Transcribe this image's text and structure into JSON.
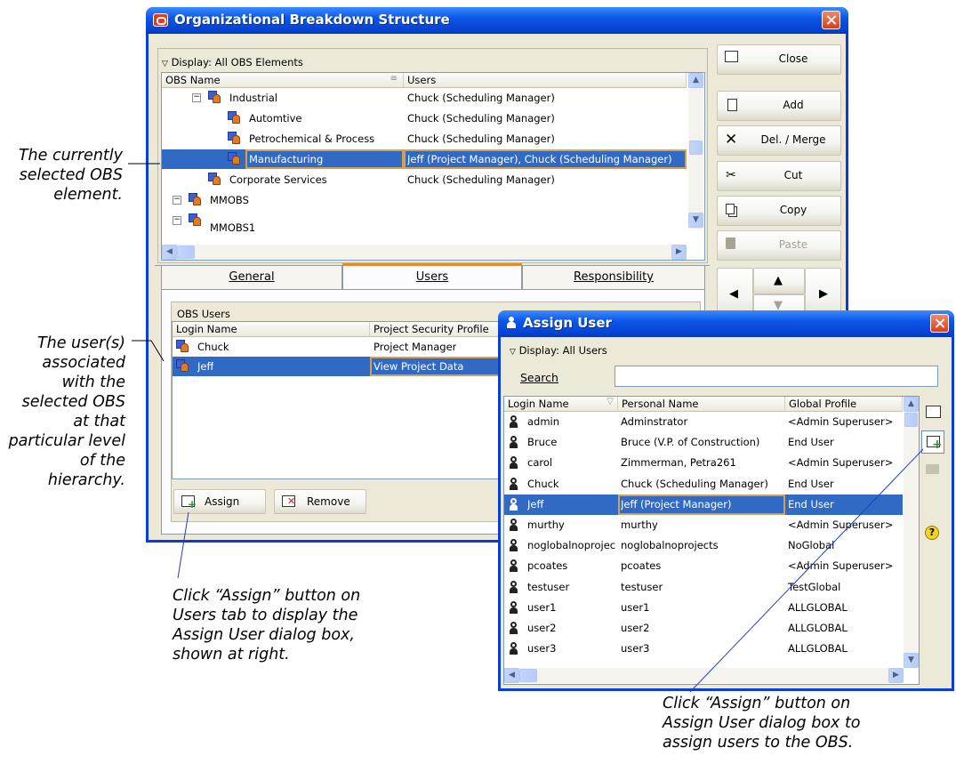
{
  "annotations": {
    "selected_obs": [
      "The currently",
      "selected OBS",
      "element."
    ],
    "users_assoc": [
      "The user(s)",
      "associated",
      "with the",
      "selected OBS",
      "at that",
      "particular level",
      "of the",
      "hierarchy."
    ],
    "assign_click": [
      "Click “Assign” button on",
      "Users tab to display the",
      "Assign User dialog box,",
      "shown at right."
    ],
    "assign_dialog_click": [
      "Click “Assign” button on",
      "Assign User dialog box to",
      "assign users to the OBS."
    ]
  },
  "obs_window": {
    "title": "Organizational Breakdown Structure",
    "display_label": "Display: All OBS Elements",
    "columns": [
      "OBS Name",
      "Users"
    ],
    "rows": [
      {
        "name": "Industrial",
        "users": "Chuck (Scheduling Manager)"
      },
      {
        "name": "Automtive",
        "users": "Chuck (Scheduling Manager)"
      },
      {
        "name": "Petrochemical & Process",
        "users": "Chuck (Scheduling Manager)"
      },
      {
        "name": "Manufacturing",
        "users": "Jeff (Project Manager), Chuck (Scheduling Manager)"
      },
      {
        "name": "Corporate Services",
        "users": "Chuck (Scheduling Manager)"
      },
      {
        "name": "MMOBS",
        "users": ""
      },
      {
        "name": "MMOBS1",
        "users": ""
      }
    ],
    "buttons": {
      "close": "Close",
      "add": "Add",
      "del_merge": "Del. / Merge",
      "cut": "Cut",
      "copy": "Copy",
      "paste": "Paste"
    },
    "tabs": [
      "General",
      "Users",
      "Responsibility"
    ],
    "obs_users_label": "OBS Users",
    "user_columns": [
      "Login Name",
      "Project Security Profile"
    ],
    "user_rows": [
      {
        "login": "Chuck",
        "profile": "Project Manager"
      },
      {
        "login": "Jeff",
        "profile": "View Project Data"
      }
    ],
    "assign_label": "Assign",
    "remove_label": "Remove"
  },
  "assign_window": {
    "title": "Assign User",
    "display_label": "Display: All Users",
    "search_label": "Search",
    "search_value": "",
    "columns": [
      "Login Name",
      "Personal Name",
      "Global Profile"
    ],
    "rows": [
      {
        "login": "admin",
        "personal": "Adminstrator",
        "profile": "<Admin Superuser>"
      },
      {
        "login": "Bruce",
        "personal": "Bruce (V.P. of Construction)",
        "profile": "End User"
      },
      {
        "login": "carol",
        "personal": "Zimmerman, Petra261",
        "profile": "<Admin Superuser>"
      },
      {
        "login": "Chuck",
        "personal": "Chuck (Scheduling Manager)",
        "profile": "End User"
      },
      {
        "login": "Jeff",
        "personal": "Jeff (Project Manager)",
        "profile": "End User"
      },
      {
        "login": "murthy",
        "personal": "murthy",
        "profile": "<Admin Superuser>"
      },
      {
        "login": "noglobalnoprojec",
        "personal": "noglobalnoprojects",
        "profile": "NoGlobal"
      },
      {
        "login": "pcoates",
        "personal": "pcoates",
        "profile": "<Admin Superuser>"
      },
      {
        "login": "testuser",
        "personal": "testuser",
        "profile": "TestGlobal"
      },
      {
        "login": "user1",
        "personal": "user1",
        "profile": "ALLGLOBAL"
      },
      {
        "login": "user2",
        "personal": "user2",
        "profile": "ALLGLOBAL"
      },
      {
        "login": "user3",
        "personal": "user3",
        "profile": "ALLGLOBAL"
      }
    ]
  },
  "colors": {
    "titlebar": "#0b57e8",
    "selection": "#316ac5",
    "dialog_bg": "#ece9d8",
    "close_red": "#dc3d17"
  }
}
